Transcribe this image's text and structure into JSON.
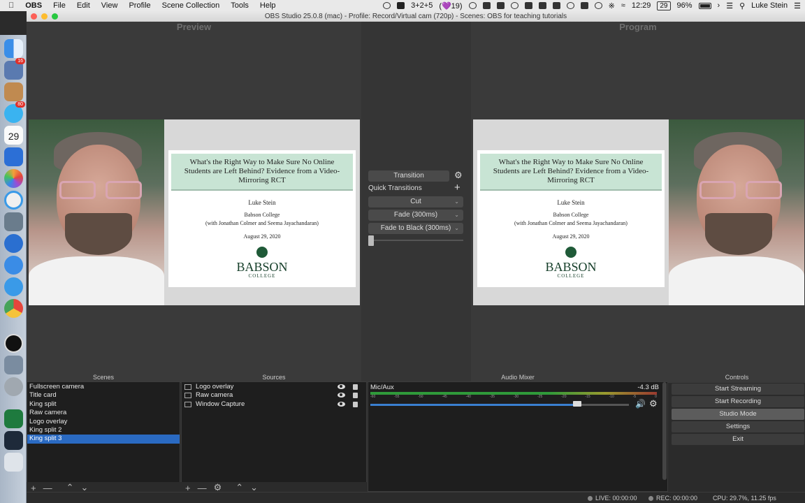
{
  "menubar": {
    "app_name": "OBS",
    "items": [
      "File",
      "Edit",
      "View",
      "Profile",
      "Scene Collection",
      "Tools",
      "Help"
    ],
    "extension_text": "3+2+5",
    "heart_text": "(💜19)",
    "date_box": "29",
    "battery": "96%",
    "clock": "12:29",
    "user": "Luke Stein"
  },
  "window": {
    "title": "OBS Studio 25.0.8 (mac) - Profile: Record/Virtual cam (720p) - Scenes: OBS for teaching tutorials"
  },
  "preview": {
    "label": "Preview"
  },
  "program": {
    "label": "Program"
  },
  "slide": {
    "title": "What's the Right Way to Make Sure No Online Students are Left Behind? Evidence from a Video-Mirroring RCT",
    "author": "Luke Stein",
    "affiliation": "Babson College",
    "coauthors": "(with Jonathan Colmer and Seema Jayachandaran)",
    "date": "August 29, 2020",
    "logo_text": "BABSON",
    "logo_sub": "COLLEGE"
  },
  "transition_panel": {
    "transition_label": "Transition",
    "quick_transitions_label": "Quick Transitions",
    "options": [
      "Cut",
      "Fade (300ms)",
      "Fade to Black (300ms)"
    ]
  },
  "scenes": {
    "header": "Scenes",
    "items": [
      "Fullscreen camera",
      "Title card",
      "King split",
      "Raw camera",
      "Logo overlay",
      "King split 2",
      "King split 3"
    ],
    "selected_index": 6
  },
  "sources": {
    "header": "Sources",
    "items": [
      "Logo overlay",
      "Raw camera",
      "Window Capture"
    ]
  },
  "audio_mixer": {
    "header": "Audio Mixer",
    "channel": "Mic/Aux",
    "level": "-4.3 dB",
    "ticks": [
      "-60",
      "-55",
      "-50",
      "-45",
      "-40",
      "-35",
      "-30",
      "-25",
      "-20",
      "-15",
      "-10",
      "-5",
      "0"
    ],
    "volume_fraction": 0.8
  },
  "controls": {
    "header": "Controls",
    "buttons": [
      "Start Streaming",
      "Start Recording",
      "Studio Mode",
      "Settings",
      "Exit"
    ],
    "active_index": 2
  },
  "status": {
    "live": "LIVE: 00:00:00",
    "rec": "REC: 00:00:00",
    "cpu": "CPU: 29.7%, 11.25 fps"
  }
}
